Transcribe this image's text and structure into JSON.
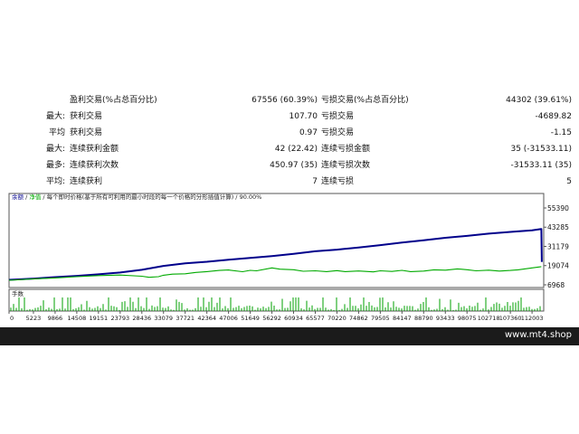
{
  "stats_rows": [
    {
      "prefix": "",
      "label_a": "盈利交易(%占总百分比)",
      "value_a": "67556 (60.39%)",
      "label_b": "亏损交易(%占总百分比)",
      "value_b": "44302 (39.61%)"
    },
    {
      "prefix": "最大:",
      "label_a": "获利交易",
      "value_a": "107.70",
      "label_b": "亏损交易",
      "value_b": "-4689.82"
    },
    {
      "prefix": "平均",
      "label_a": "获利交易",
      "value_a": "0.97",
      "label_b": "亏损交易",
      "value_b": "-1.15"
    },
    {
      "prefix": "最大:",
      "label_a": "连续获利金额",
      "value_a": "42 (22.42)",
      "label_b": "连续亏损金额",
      "value_b": "35 (-31533.11)"
    },
    {
      "prefix": "最多:",
      "label_a": "连续获利次数",
      "value_a": "450.97 (35)",
      "label_b": "连续亏损次数",
      "value_b": "-31533.11 (35)"
    },
    {
      "prefix": "平均:",
      "label_a": "连续获利",
      "value_a": "7",
      "label_b": "连续亏损",
      "value_b": "5"
    }
  ],
  "chart_data": {
    "type": "line",
    "legend_text": {
      "balance": "余额",
      "equity": "净值",
      "description": "每个即时价格(基于所有可利用的最小时段的每一个价格的分形插值计算)",
      "quality": "90.00%"
    },
    "volume_label": "手数",
    "y_ticks": [
      55390,
      43285,
      31179,
      19074,
      6968
    ],
    "y_range": [
      6968,
      55390
    ],
    "x_ticks": [
      "0",
      "5223",
      "9866",
      "14508",
      "19151",
      "23793",
      "28436",
      "33079",
      "37721",
      "42364",
      "47006",
      "51649",
      "56292",
      "60934",
      "65577",
      "70220",
      "74862",
      "79505",
      "84147",
      "88790",
      "93433",
      "98075",
      "102718",
      "107360",
      "112003"
    ],
    "x_range": [
      0,
      114500
    ],
    "series": [
      {
        "name": "余额",
        "color": "#00008b",
        "x": [
          0,
          5223,
          9866,
          14508,
          19151,
          23793,
          28436,
          33079,
          37721,
          42364,
          47006,
          51649,
          56292,
          60934,
          65577,
          70220,
          74862,
          79505,
          84147,
          88790,
          93433,
          98075,
          102718,
          107360,
          112003,
          114000,
          114100
        ],
        "y": [
          10100,
          10900,
          11800,
          12600,
          13600,
          14700,
          16400,
          18900,
          20500,
          21500,
          22800,
          23900,
          25100,
          26500,
          28100,
          29100,
          30500,
          32000,
          33600,
          35000,
          36600,
          37800,
          39200,
          40300,
          41300,
          42100,
          21400
        ]
      },
      {
        "name": "净值",
        "color": "#00aa00",
        "x": [
          0,
          5223,
          9866,
          14508,
          19151,
          23793,
          28436,
          30000,
          32000,
          33079,
          35000,
          37721,
          40000,
          42364,
          45000,
          47006,
          50000,
          51649,
          53000,
          56292,
          58000,
          60934,
          63000,
          65577,
          68000,
          70220,
          72000,
          74862,
          78000,
          79505,
          82000,
          84147,
          86000,
          88790,
          91000,
          93433,
          96000,
          98075,
          100000,
          102718,
          105000,
          107360,
          109000,
          112003,
          114000
        ],
        "y": [
          9800,
          10700,
          11300,
          12100,
          12800,
          13100,
          12400,
          11700,
          12100,
          13000,
          13700,
          13900,
          14800,
          15300,
          16000,
          16300,
          15200,
          16100,
          15800,
          17600,
          16800,
          16500,
          15500,
          15800,
          15300,
          15900,
          15300,
          15700,
          15100,
          15800,
          15400,
          16100,
          15300,
          15600,
          16400,
          16200,
          17000,
          16500,
          15800,
          16200,
          15600,
          16000,
          16400,
          17600,
          18400
        ]
      }
    ]
  },
  "footer": {
    "site": "www.mt4.shop"
  }
}
